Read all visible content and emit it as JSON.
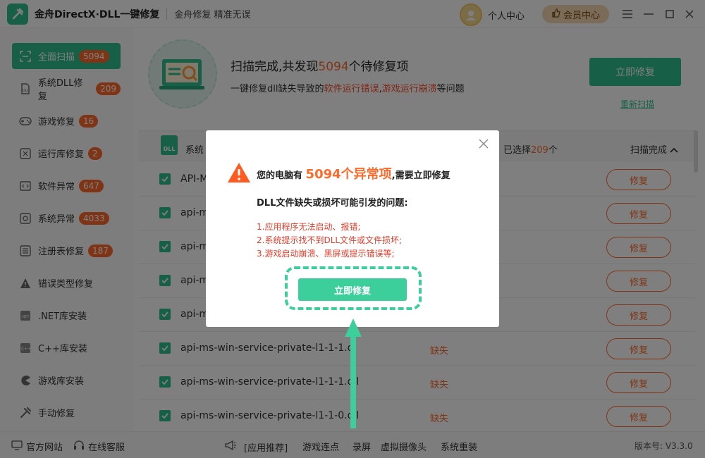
{
  "titlebar": {
    "app_title": "金舟DirectX·DLL一键修复",
    "slogan": "金舟修复 精准无误",
    "user_center": "个人中心",
    "member_center": "会员中心"
  },
  "sidebar": {
    "items": [
      {
        "label": "全面扫描",
        "badge": "5094",
        "icon": "scan-icon"
      },
      {
        "label": "系统DLL修复",
        "badge": "209",
        "icon": "dll-icon"
      },
      {
        "label": "游戏修复",
        "badge": "16",
        "icon": "gamepad-icon"
      },
      {
        "label": "运行库修复",
        "badge": "2",
        "icon": "vs-icon"
      },
      {
        "label": "软件异常",
        "badge": "647",
        "icon": "code-icon"
      },
      {
        "label": "系统异常",
        "badge": "4033",
        "icon": "gear-icon"
      },
      {
        "label": "注册表修复",
        "badge": "187",
        "icon": "list-icon"
      },
      {
        "label": "错误类型修复",
        "badge": "",
        "icon": "warning-icon"
      },
      {
        "label": ".NET库安装",
        "badge": "",
        "icon": "net-icon"
      },
      {
        "label": "C++库安装",
        "badge": "",
        "icon": "cpp-icon"
      },
      {
        "label": "游戏库安装",
        "badge": "",
        "icon": "pacman-icon"
      },
      {
        "label": "手动修复",
        "badge": "",
        "icon": "tools-icon"
      }
    ]
  },
  "main": {
    "scan_title_pre": "扫描完成,共发现",
    "scan_count": "5094",
    "scan_title_post": "个待修复项",
    "sub_pre": "一键修复dll缺失导致的",
    "sub_red1": "软件运行错误",
    "sub_mid": ",",
    "sub_red2": "游戏运行崩溃",
    "sub_post": "等问题",
    "fix_all": "立即修复",
    "rescan": "重新扫描",
    "table_head": {
      "icon_text": "DLL",
      "category": "系统",
      "selected_pre": "已选择",
      "selected_count": "209",
      "selected_post": "个",
      "status": "扫描完成"
    },
    "rows": [
      {
        "name": "API-M",
        "status": "",
        "action": "修复"
      },
      {
        "name": "api-m",
        "status": "",
        "action": "修复"
      },
      {
        "name": "api-m",
        "status": "",
        "action": "修复"
      },
      {
        "name": "api-m",
        "status": "",
        "action": "修复"
      },
      {
        "name": "api-m",
        "status": "",
        "action": "修复"
      },
      {
        "name": "api-ms-win-service-private-l1-1-1.dl",
        "status": "缺失",
        "action": "修复"
      },
      {
        "name": "api-ms-win-service-private-l1-1-1.dll",
        "status": "缺失",
        "action": "修复"
      },
      {
        "name": "api-ms-win-service-private-l1-1-0.dll",
        "status": "缺失",
        "action": "修复"
      }
    ]
  },
  "footer": {
    "official_site": "官方网站",
    "online_service": "在线客服",
    "recommend": "[应用推荐]",
    "links": [
      "游戏连点",
      "录屏",
      "虚拟摄像头",
      "系统重装"
    ],
    "version": "版本号: V3.3.0"
  },
  "modal": {
    "head_pre": "您的电脑有",
    "head_big": "5094个异常项",
    "head_post": ",需要立即修复",
    "sub": "DLL文件缺失或损坏可能引发的问题:",
    "issues": [
      "1.应用程序无法启动、报错;",
      "2.系统提示找不到DLL文件或文件损坏;",
      "3.游戏启动崩溃、黑屏或提示错误等;"
    ],
    "button": "立即修复"
  },
  "colors": {
    "accent": "#2fbf8c",
    "orange": "#ff6a2b",
    "red": "#e83c2a"
  }
}
